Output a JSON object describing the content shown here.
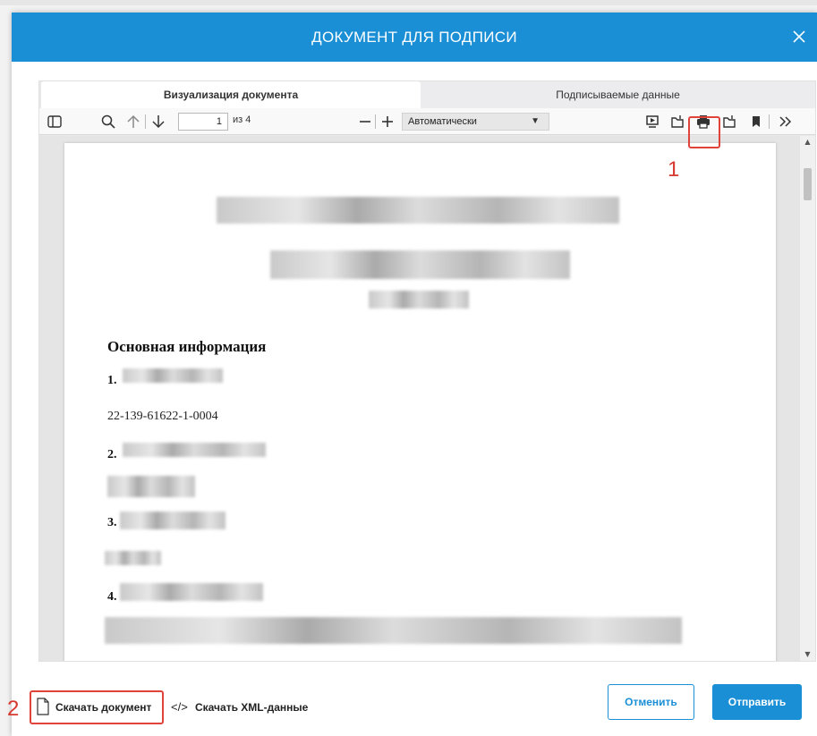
{
  "modal": {
    "title": "ДОКУМЕНТ ДЛЯ ПОДПИСИ",
    "close_icon": "close-icon"
  },
  "tabs": [
    {
      "label": "Визуализация документа",
      "active": true
    },
    {
      "label": "Подписываемые данные",
      "active": false
    }
  ],
  "toolbar": {
    "page_current": "1",
    "page_of": "из 4",
    "zoom": "Автоматически"
  },
  "document": {
    "heading": "Основная информация",
    "items": [
      {
        "num": "1.",
        "value": "22-139-61622-1-0004"
      },
      {
        "num": "2."
      },
      {
        "num": "3."
      },
      {
        "num": "4."
      }
    ]
  },
  "annotations": {
    "one": "1",
    "two": "2"
  },
  "footer": {
    "download_doc": "Скачать документ",
    "download_xml": "Скачать XML-данные",
    "cancel": "Отменить",
    "send": "Отправить"
  },
  "colors": {
    "accent": "#1a8fd6",
    "highlight": "#e0433a"
  }
}
